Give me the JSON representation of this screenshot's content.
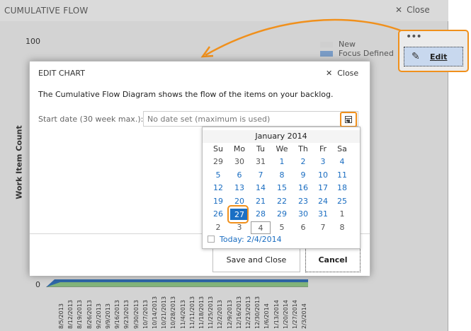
{
  "window": {
    "title": "CUMULATIVE FLOW",
    "close_label": "Close"
  },
  "chart_data": {
    "type": "area",
    "ylabel": "Work Item Count",
    "yticks": [
      "100",
      "0"
    ],
    "legend": [
      "New",
      "Focus Defined"
    ],
    "legend_colors": [
      "#cfcfcf",
      "#7a9cc6"
    ],
    "x": [
      "8/5/2013",
      "8/12/2013",
      "8/19/2013",
      "8/26/2013",
      "9/2/2013",
      "9/9/2013",
      "9/16/2013",
      "9/23/2013",
      "9/30/2013",
      "10/7/2013",
      "10/14/2013",
      "10/21/2013",
      "10/28/2013",
      "11/4/2013",
      "11/11/2013",
      "11/18/2013",
      "11/25/2013",
      "12/2/2013",
      "12/9/2013",
      "12/16/2013",
      "12/23/2013",
      "12/30/2013",
      "1/6/2014",
      "1/13/2014",
      "1/20/2014",
      "1/27/2014",
      "2/3/2014"
    ]
  },
  "edit_menu": {
    "dots": "•••",
    "edit_label": "Edit",
    "icon": "pencil-icon"
  },
  "dialog": {
    "title": "EDIT CHART",
    "close_label": "Close",
    "description": "The Cumulative Flow Diagram shows the flow of the items on your backlog.",
    "start_date_label": "Start date (30 week max.):",
    "start_date_value": "No date set (maximum is used)",
    "save_label": "Save and Close",
    "cancel_label": "Cancel"
  },
  "calendar": {
    "month": "January 2014",
    "weekdays": [
      "Su",
      "Mo",
      "Tu",
      "We",
      "Th",
      "Fr",
      "Sa"
    ],
    "weeks": [
      [
        "29",
        "30",
        "31",
        "1",
        "2",
        "3",
        "4"
      ],
      [
        "5",
        "6",
        "7",
        "8",
        "9",
        "10",
        "11"
      ],
      [
        "12",
        "13",
        "14",
        "15",
        "16",
        "17",
        "18"
      ],
      [
        "19",
        "20",
        "21",
        "22",
        "23",
        "24",
        "25"
      ],
      [
        "26",
        "27",
        "28",
        "29",
        "30",
        "31",
        "1"
      ],
      [
        "2",
        "3",
        "4",
        "5",
        "6",
        "7",
        "8"
      ]
    ],
    "selected": "27",
    "today_label": "Today: 2/4/2014"
  }
}
